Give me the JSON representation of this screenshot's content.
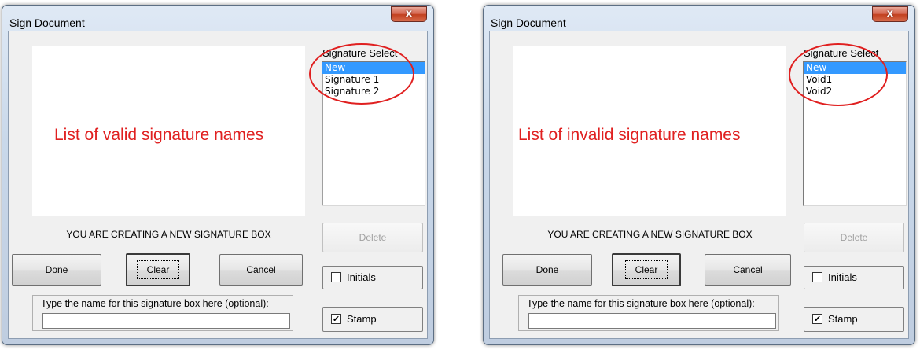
{
  "dialogs": [
    {
      "title": "Sign Document",
      "close_label": "x",
      "annotation": "List of valid signature names",
      "signature_select_label": "Signature Select",
      "signature_items": [
        {
          "label": "New",
          "selected": true
        },
        {
          "label": "Signature 1",
          "selected": false
        },
        {
          "label": "Signature 2",
          "selected": false
        }
      ],
      "status_text": "YOU ARE CREATING A NEW SIGNATURE BOX",
      "delete_label": "Delete",
      "done_label": "Done",
      "clear_label": "Clear",
      "cancel_label": "Cancel",
      "initials_label": "Initials",
      "initials_checked": false,
      "stamp_label": "Stamp",
      "stamp_checked": true,
      "name_prompt": "Type the name for this signature box here (optional):",
      "name_value": ""
    },
    {
      "title": "Sign Document",
      "close_label": "x",
      "annotation": "List of invalid signature names",
      "signature_select_label": "Signature Select",
      "signature_items": [
        {
          "label": "New",
          "selected": true
        },
        {
          "label": "Void1",
          "selected": false
        },
        {
          "label": "Void2",
          "selected": false
        }
      ],
      "status_text": "YOU ARE CREATING A NEW SIGNATURE BOX",
      "delete_label": "Delete",
      "done_label": "Done",
      "clear_label": "Clear",
      "cancel_label": "Cancel",
      "initials_label": "Initials",
      "initials_checked": false,
      "stamp_label": "Stamp",
      "stamp_checked": true,
      "name_prompt": "Type the name for this signature box here (optional):",
      "name_value": ""
    }
  ],
  "colors": {
    "annotation": "#e02020",
    "selection": "#3399ff",
    "close_button": "#c2401f"
  }
}
